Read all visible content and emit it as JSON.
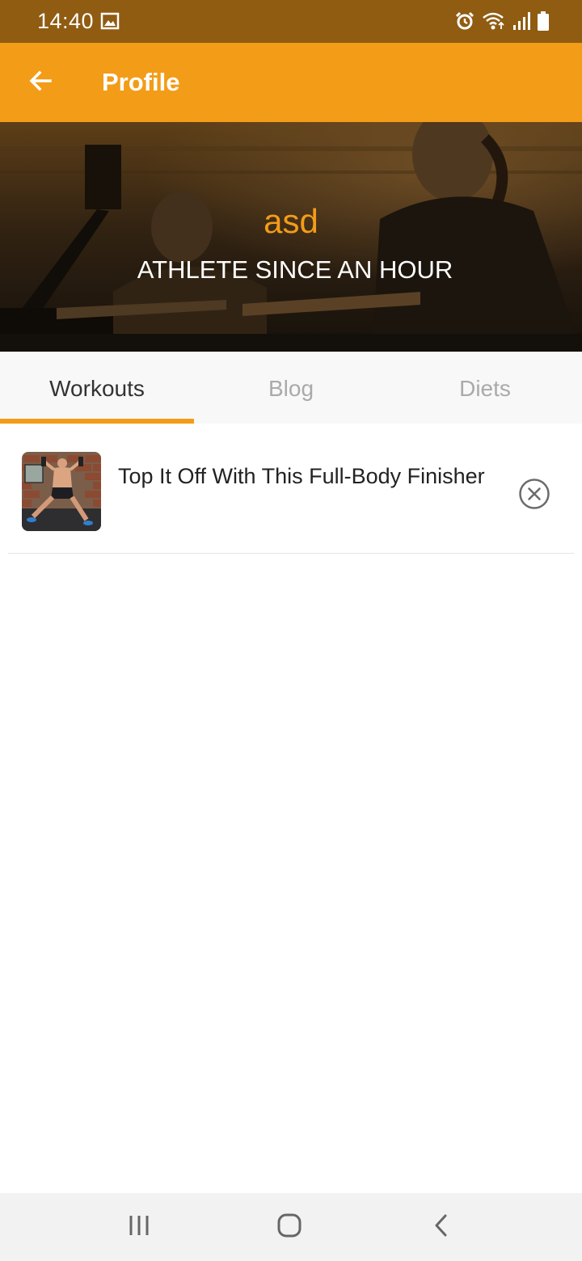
{
  "status_bar": {
    "time": "14:40",
    "icons": [
      "gallery-icon",
      "alarm-icon",
      "wifi-icon",
      "signal-icon",
      "battery-icon"
    ]
  },
  "app_bar": {
    "title": "Profile",
    "back_icon": "arrow-left-icon",
    "background": "#f39c18"
  },
  "hero": {
    "name": "asd",
    "subtitle": "ATHLETE SINCE AN HOUR",
    "name_color": "#f39c18"
  },
  "tabs": [
    {
      "label": "Workouts",
      "active": true
    },
    {
      "label": "Blog",
      "active": false
    },
    {
      "label": "Diets",
      "active": false
    }
  ],
  "workouts": [
    {
      "title": "Top It Off With This Full-Body Finisher",
      "action_icon": "close-circle-icon"
    }
  ],
  "nav_bar": {
    "icons": [
      "recent-apps-icon",
      "home-icon",
      "back-icon"
    ]
  }
}
